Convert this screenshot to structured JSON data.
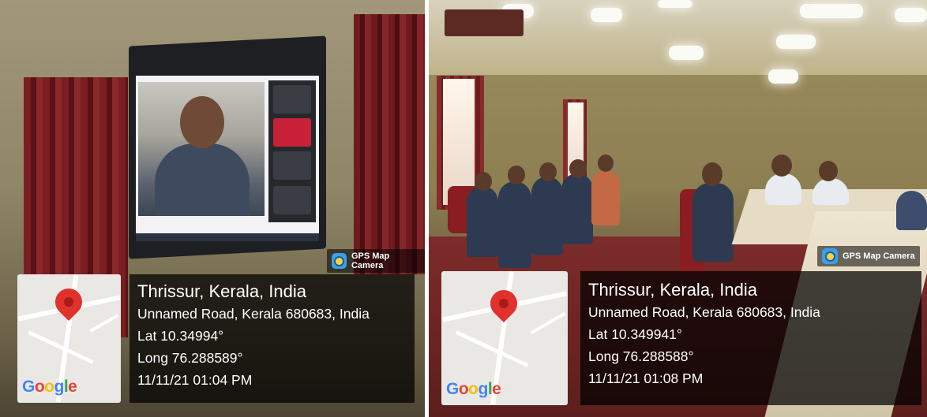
{
  "photos": [
    {
      "badge": "GPS Map Camera",
      "map_logo": "Google",
      "place": "Thrissur, Kerala, India",
      "address": "Unnamed Road, Kerala 680683, India",
      "lat": "Lat 10.34994°",
      "long": "Long 76.288589°",
      "datetime": "11/11/21 01:04 PM"
    },
    {
      "badge": "GPS Map Camera",
      "map_logo": "Google",
      "place": "Thrissur, Kerala, India",
      "address": "Unnamed Road, Kerala 680683, India",
      "lat": "Lat 10.349941°",
      "long": "Long 76.288588°",
      "datetime": "11/11/21 01:08 PM"
    }
  ],
  "icons": [
    "map-pin-icon",
    "gps-map-camera-icon"
  ],
  "colors": {
    "pin": "#e0312d",
    "overlay": "#000000"
  }
}
